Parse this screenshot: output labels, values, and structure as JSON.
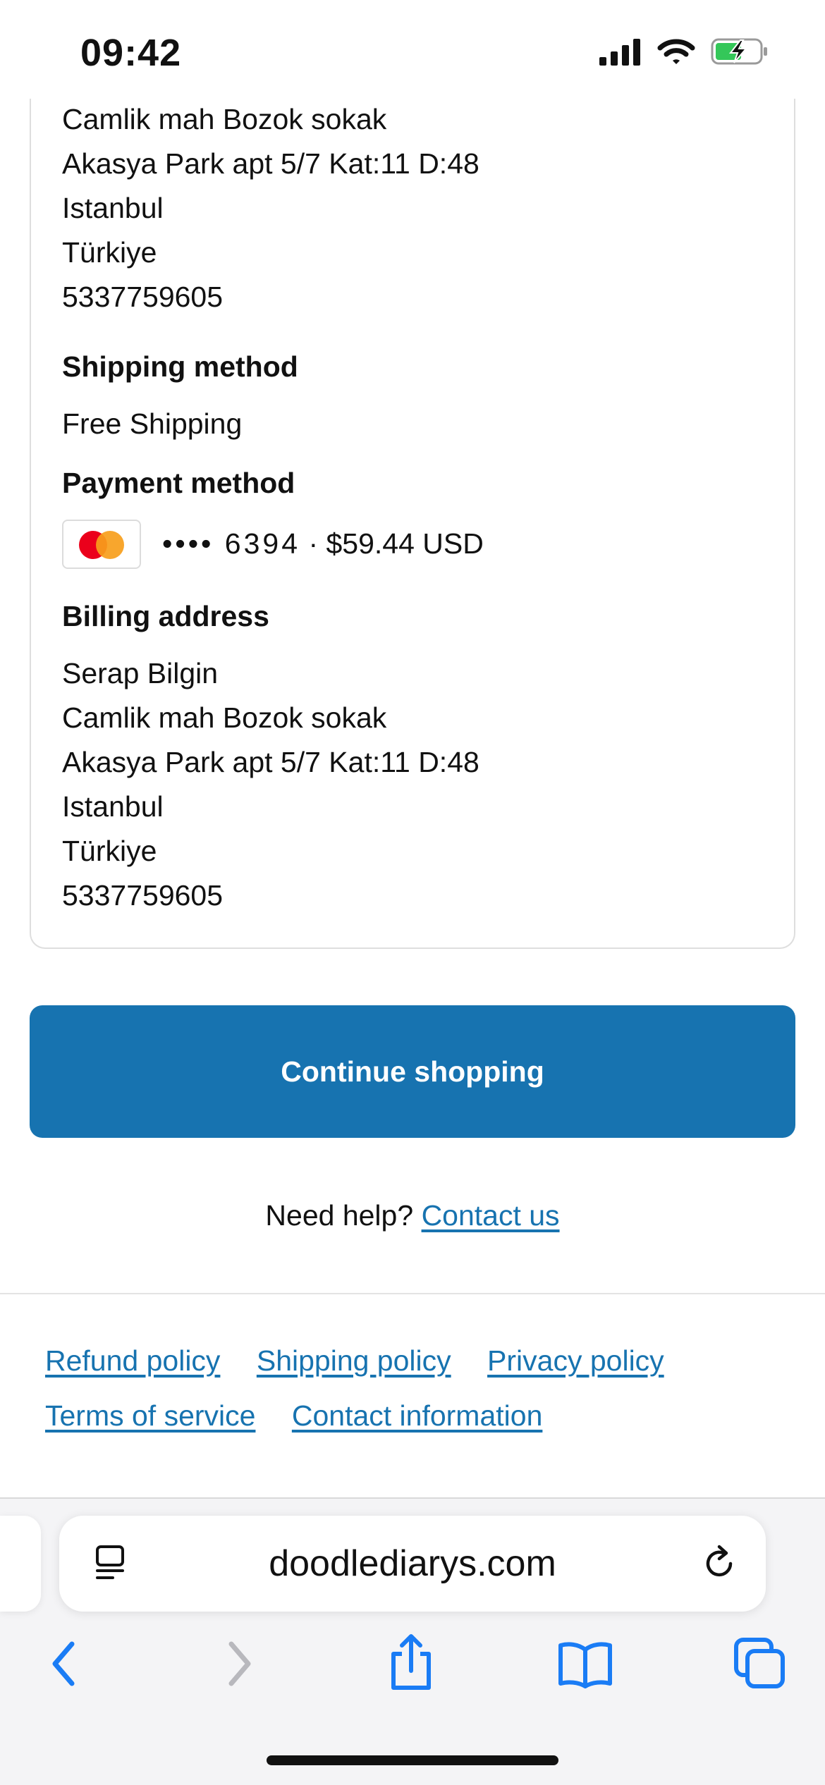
{
  "status_bar": {
    "time": "09:42"
  },
  "shipping_address": {
    "lines": [
      "Camlik mah Bozok sokak",
      "Akasya Park apt 5/7 Kat:11 D:48",
      "Istanbul",
      "Türkiye",
      "5337759605"
    ]
  },
  "shipping_method": {
    "heading": "Shipping method",
    "value": "Free Shipping"
  },
  "payment_method": {
    "heading": "Payment method",
    "card_icon": "mastercard-icon",
    "masked": "•••• 6394",
    "separator": "·",
    "amount": "$59.44 USD"
  },
  "billing_address": {
    "heading": "Billing address",
    "lines": [
      "Serap Bilgin",
      "Camlik mah Bozok sokak",
      "Akasya Park apt 5/7 Kat:11 D:48",
      "Istanbul",
      "Türkiye",
      "5337759605"
    ]
  },
  "continue_button": {
    "label": "Continue shopping",
    "color": "#1773b0"
  },
  "help": {
    "text": "Need help?",
    "link": "Contact us"
  },
  "footer": {
    "links": [
      "Refund policy",
      "Shipping policy",
      "Privacy policy",
      "Terms of service",
      "Contact information"
    ]
  },
  "browser": {
    "url": "doodlediarys.com",
    "accent": "#1a7cf5"
  }
}
